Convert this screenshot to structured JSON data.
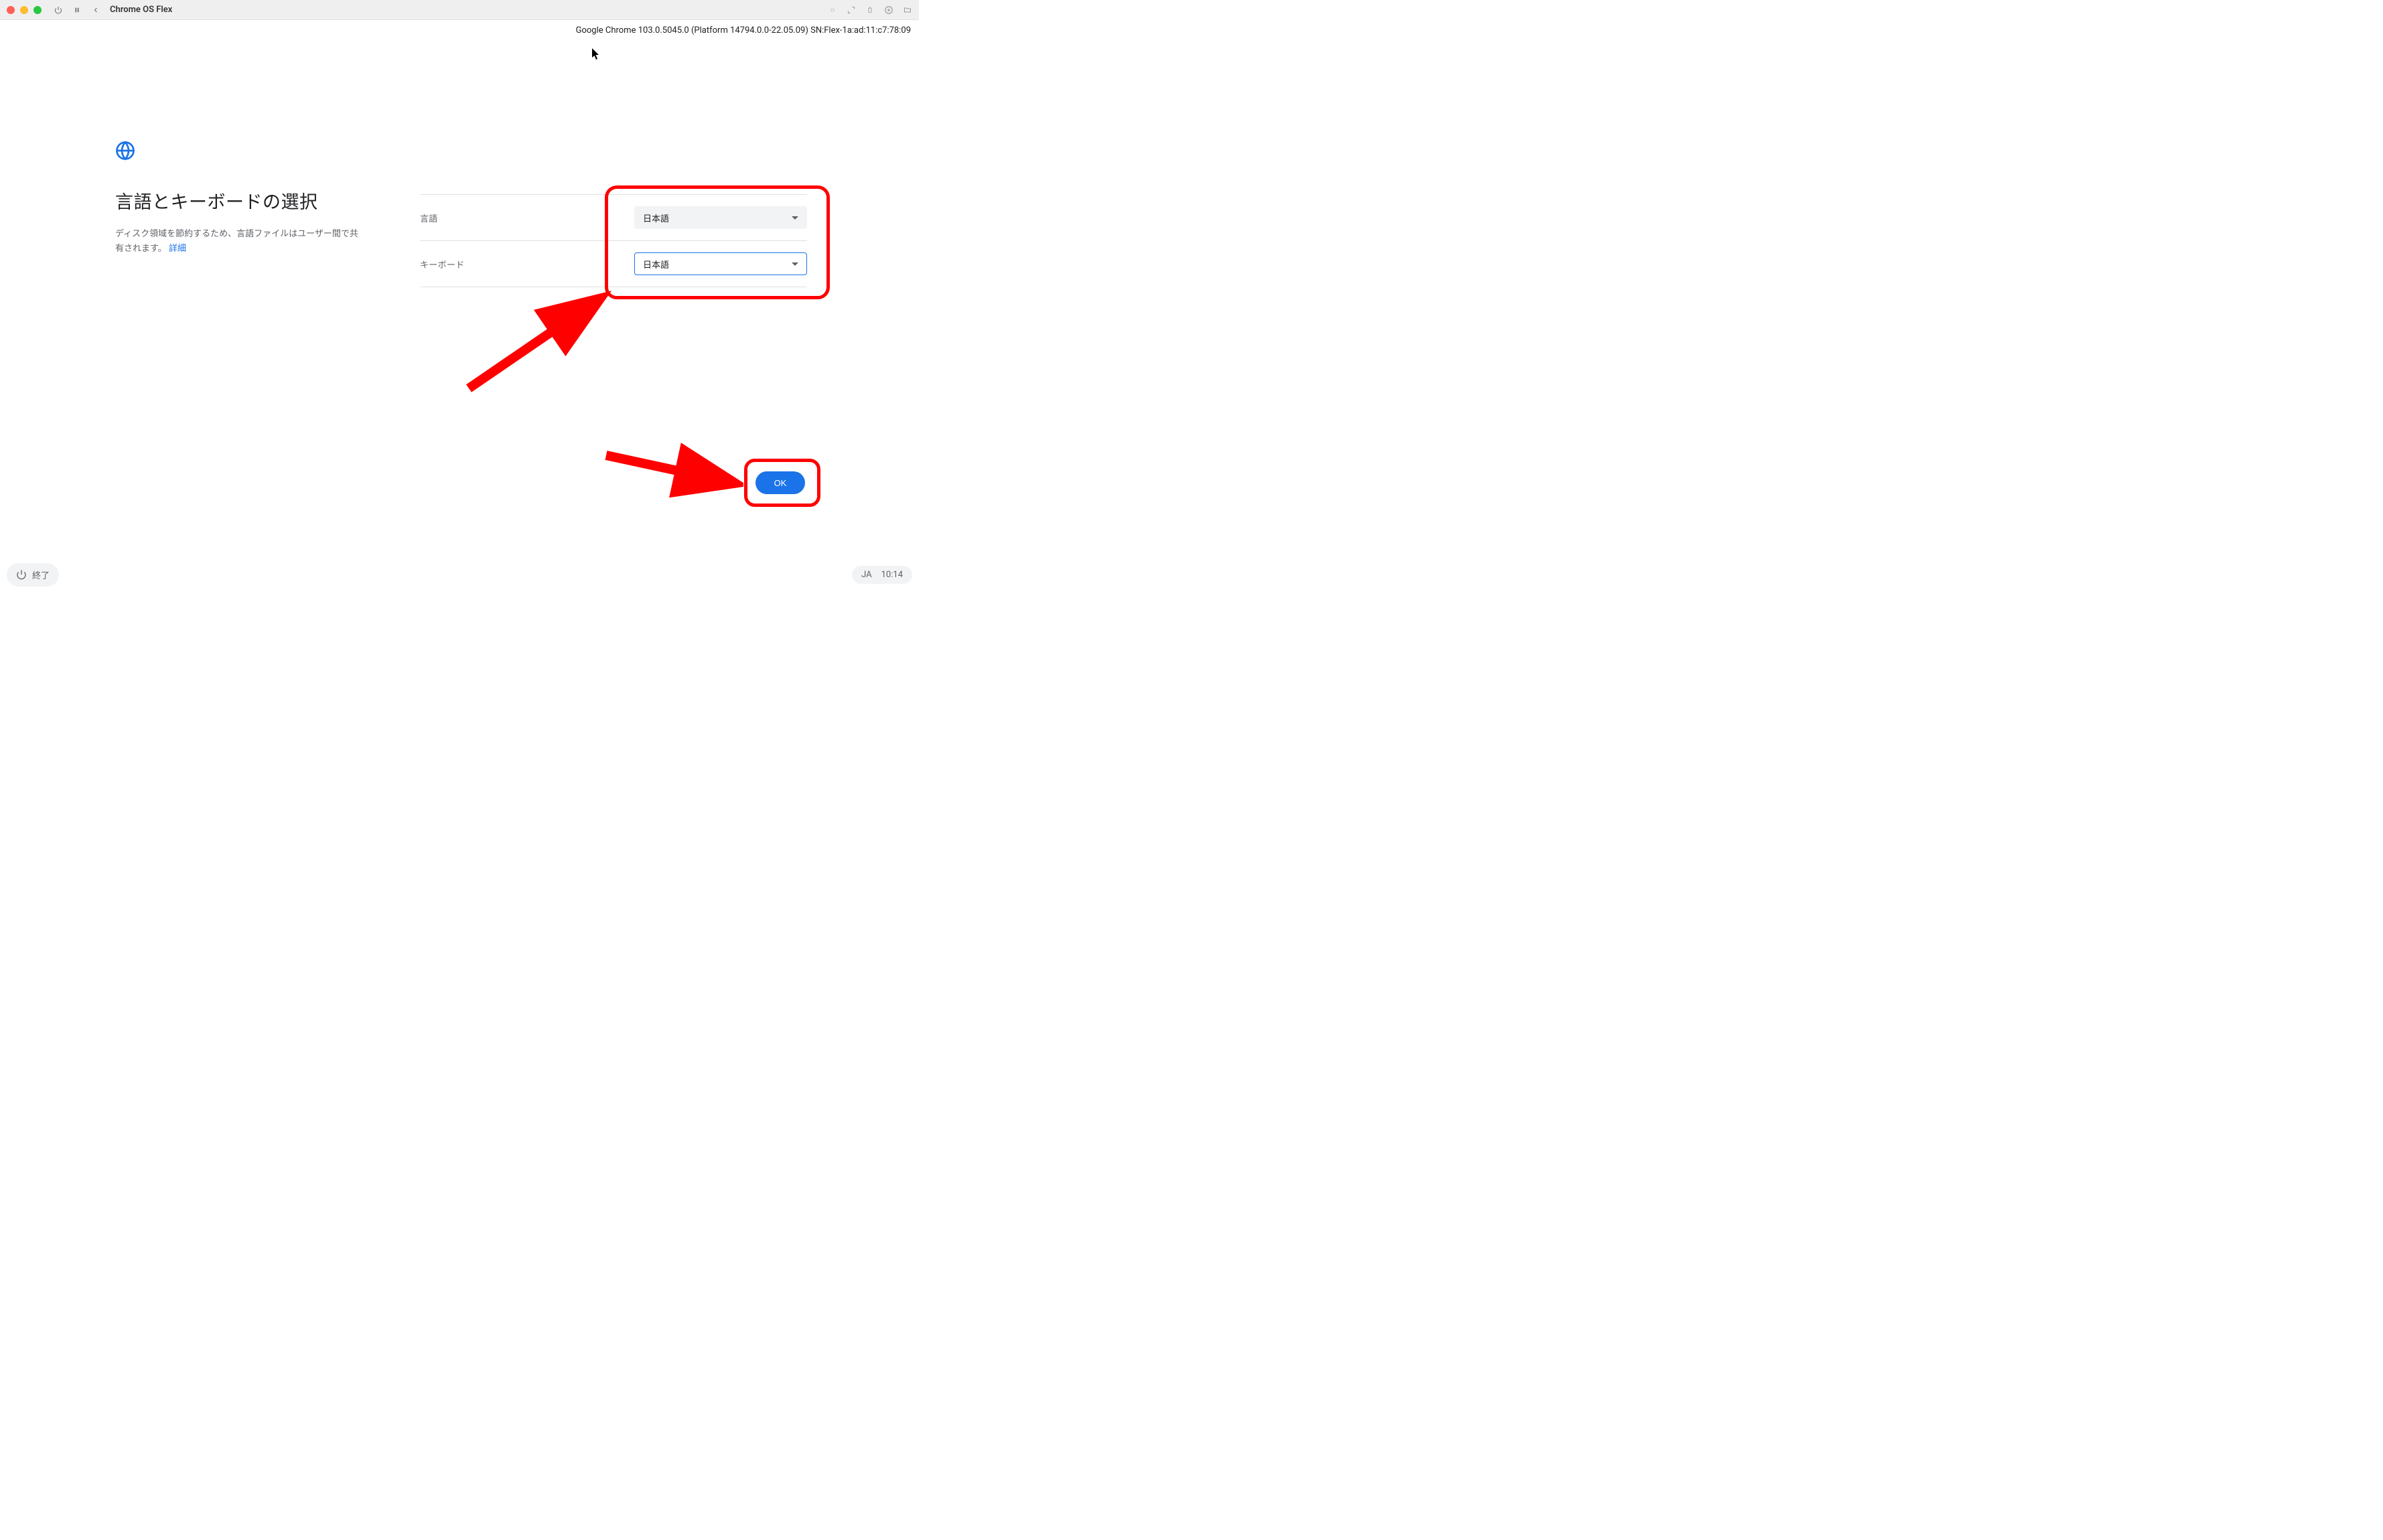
{
  "titlebar": {
    "title": "Chrome OS Flex"
  },
  "version_info": "Google Chrome 103.0.5045.0 (Platform 14794.0.0-22.05.09) SN:Flex-1a:ad:11:c7:78:09",
  "page": {
    "title": "言語とキーボードの選択",
    "description_part1": "ディスク領域を節約するため、言語ファイルはユーザー間で共有されます。",
    "link_text": "詳細"
  },
  "settings": {
    "language_label": "言語",
    "language_value": "日本語",
    "keyboard_label": "キーボード",
    "keyboard_value": "日本語"
  },
  "buttons": {
    "ok": "OK",
    "shutdown": "終了"
  },
  "bottom_bar": {
    "ime": "JA",
    "time": "10:14"
  }
}
